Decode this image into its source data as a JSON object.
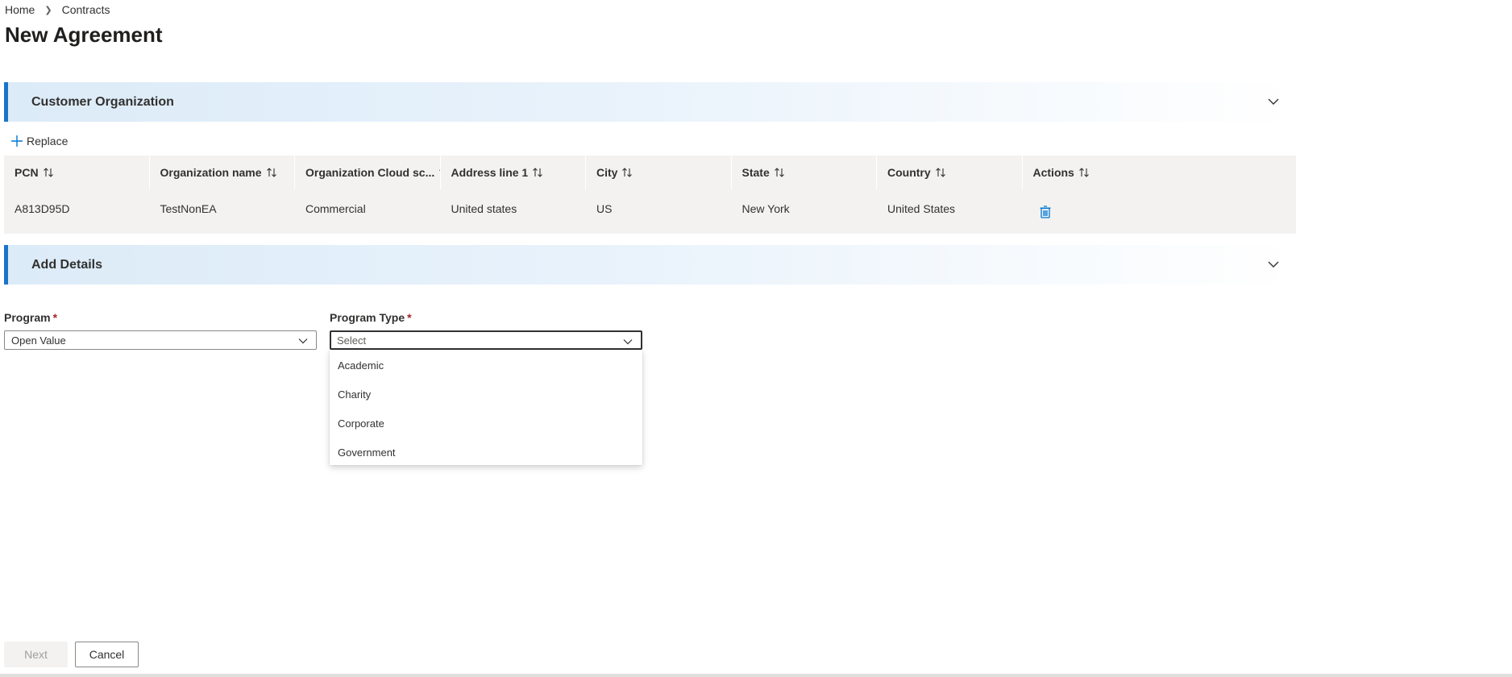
{
  "breadcrumb": {
    "items": [
      "Home",
      "Contracts"
    ]
  },
  "page": {
    "title": "New Agreement"
  },
  "sections": {
    "customer_org": {
      "title": "Customer Organization",
      "collapsed": false
    },
    "add_details": {
      "title": "Add Details",
      "collapsed": false
    }
  },
  "toolbar": {
    "replace_label": "Replace"
  },
  "grid": {
    "columns": [
      "PCN",
      "Organization name",
      "Organization Cloud sc...",
      "Address line 1",
      "City",
      "State",
      "Country",
      "Actions"
    ],
    "rows": [
      {
        "pcn": "A813D95D",
        "org_name": "TestNonEA",
        "cloud": "Commercial",
        "address": "United states",
        "city": "US",
        "state": "New York",
        "country": "United States"
      }
    ]
  },
  "form": {
    "program": {
      "label": "Program",
      "required_mark": "*",
      "value": "Open Value"
    },
    "program_type": {
      "label": "Program Type",
      "required_mark": "*",
      "placeholder": "Select",
      "options": [
        "Academic",
        "Charity",
        "Corporate",
        "Government"
      ]
    }
  },
  "footer": {
    "next_label": "Next",
    "cancel_label": "Cancel"
  },
  "colors": {
    "accent": "#1a73c9",
    "required": "#a4262c",
    "grid_bg": "#f3f2f1"
  },
  "icons": {
    "chevron": "chevron-down-icon",
    "sort": "sort-arrows-icon",
    "add": "plus-icon",
    "delete": "trash-icon"
  }
}
